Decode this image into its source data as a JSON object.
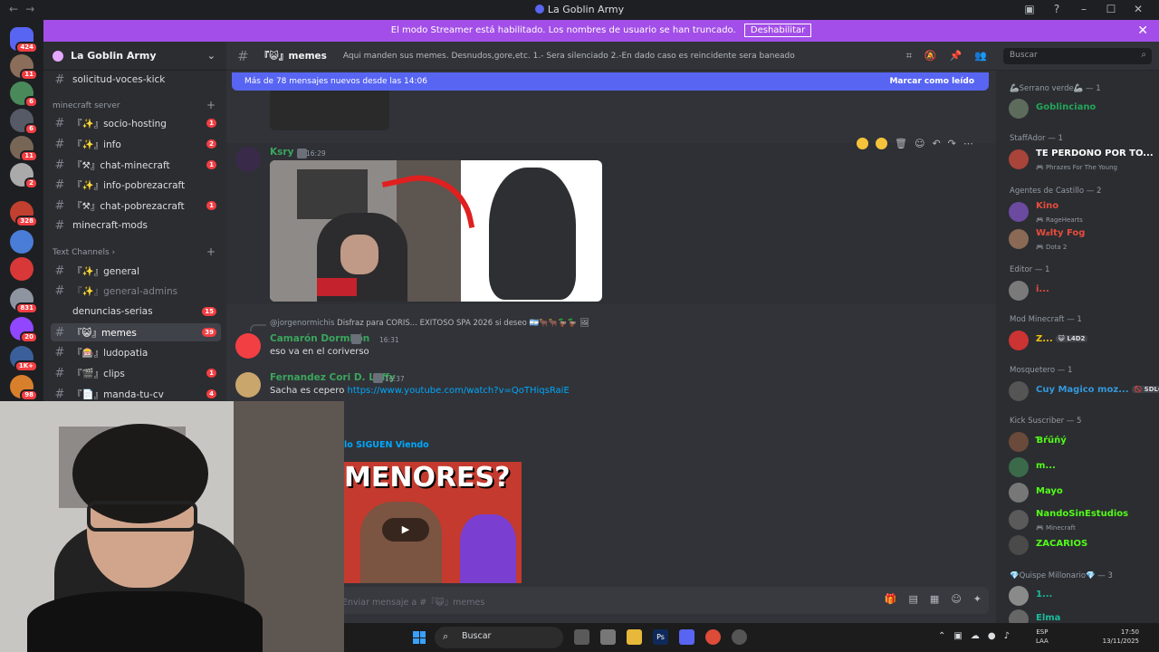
{
  "window": {
    "title": "La Goblin Army",
    "nav_back": "←",
    "nav_forward": "→",
    "controls": [
      "▣",
      "?",
      "–",
      "☐",
      "✕"
    ]
  },
  "banner": {
    "text": "El modo Streamer está habilitado. Los nombres de usuario se han truncado.",
    "button": "Deshabilitar",
    "close": "✕"
  },
  "servers": [
    {
      "badge": "424",
      "color": "#5865f2"
    },
    {
      "badge": "11",
      "color": "#8a6d5a"
    },
    {
      "badge": "6",
      "color": "#4a8a5a"
    },
    {
      "badge": "6",
      "color": "#555a66"
    },
    {
      "badge": "11",
      "color": "#776655"
    },
    {
      "badge": "2",
      "color": "#aaaaaa"
    },
    {
      "badge": "328",
      "color": "#c2402f"
    },
    {
      "badge": "",
      "color": "#4a7dd8"
    },
    {
      "badge": "",
      "color": "#d93838"
    },
    {
      "badge": "831",
      "color": "#8f95a0"
    },
    {
      "badge": "20",
      "color": "#9146ff"
    },
    {
      "badge": "1K+",
      "color": "#3a5f9a"
    },
    {
      "badge": "98",
      "color": "#d87f2b"
    }
  ],
  "sidebar": {
    "guild_name": "La Goblin Army",
    "chevron": "⌄",
    "categories": [
      "minecraft server",
      "Text Channels ›"
    ],
    "channels": [
      {
        "label": "solicitud-voces-kick",
        "badge": ""
      },
      {
        "label": "『✨』socio-hosting",
        "badge": "1"
      },
      {
        "label": "『✨』info",
        "badge": "2"
      },
      {
        "label": "『⚒』chat-minecraft",
        "badge": "1"
      },
      {
        "label": "『✨』info-pobrezacraft",
        "badge": ""
      },
      {
        "label": "『⚒』chat-pobrezacraft",
        "badge": "1"
      },
      {
        "label": "minecraft-mods",
        "badge": ""
      },
      {
        "label": "『✨』general",
        "badge": ""
      },
      {
        "label": "『✨』general-admins",
        "badge": ""
      },
      {
        "label": "denuncias-serias",
        "badge": "15"
      },
      {
        "label": "『😺』memes",
        "badge": "39"
      },
      {
        "label": "『🎰』ludopatia",
        "badge": ""
      },
      {
        "label": "『🎬』clips",
        "badge": "1"
      },
      {
        "label": "『📄』manda-tu-cv",
        "badge": "4"
      }
    ]
  },
  "chat": {
    "channel_name": "『😺』memes",
    "topic": "Aqui manden sus memes. Desnudos,gore,etc. 1.- Sera silenciado 2.-En dado caso es reincidente sera baneado",
    "search_placeholder": "Buscar",
    "new_messages": "Más de 78 mensajes nuevos desde las 14:06",
    "mark_read": "Marcar como leído",
    "composer_placeholder": "Enviar mensaje a #『😺』memes",
    "messages": [
      {
        "author": "Ksry",
        "time": "16:29",
        "color": "#3ba55d"
      },
      {
        "author": "Camarón Dormilón",
        "time": "16:31",
        "text": "eso va en el coriverso",
        "color": "#3ba55d",
        "reply_to": "@jorgenormichis",
        "reply_text": "Disfraz para CORIS... EXITOSO SPA 2026 si deseo 🇦🇷🐂🐂🦆🦆 🖼"
      },
      {
        "author": "Fernandez Cori D. Luffy",
        "time": "16:37",
        "text": "Sacha es cepero",
        "link": "https://www.youtube.com/watch?v=QoTHiqsRaiE",
        "color": "#3ba55d"
      }
    ],
    "embed_title": "lo SIGUEN Viendo",
    "embed_thumb_text": "MENORES?"
  },
  "members": {
    "groups": [
      {
        "title": "🦾Serrano verde🦾 — 1",
        "members": [
          {
            "name": "Goblinciano",
            "color": "#23a55a",
            "sub": ""
          }
        ]
      },
      {
        "title": "StaffAdor — 1",
        "members": [
          {
            "name": "TE PERDONO POR TO...",
            "color": "#ffffff",
            "sub": "🎮 Phrazes For The Young"
          }
        ]
      },
      {
        "title": "Agentes de Castillo — 2",
        "members": [
          {
            "name": "Kino",
            "color": "#e74c3c",
            "sub": "🎮 RageHearts"
          },
          {
            "name": "W𝓍lty Fog",
            "color": "#e74c3c",
            "sub": "🎮 Dota 2"
          }
        ]
      },
      {
        "title": "Editor — 1",
        "members": [
          {
            "name": "i...",
            "color": "#e74c3c",
            "sub": ""
          }
        ]
      },
      {
        "title": "Mod Minecraft — 1",
        "members": [
          {
            "name": "Z...",
            "color": "#f1c40f",
            "sub": "",
            "tag": "😺 L4D2"
          }
        ]
      },
      {
        "title": "Mosquetero — 1",
        "members": [
          {
            "name": "Cuy Magico moz...",
            "color": "#3498db",
            "sub": "",
            "tag": "🚫 SDLG"
          }
        ]
      },
      {
        "title": "Kick Suscriber — 5",
        "members": [
          {
            "name": "Ɓŕűńý",
            "color": "#53fc18",
            "sub": ""
          },
          {
            "name": "m...",
            "color": "#53fc18",
            "sub": ""
          },
          {
            "name": "Mayo",
            "color": "#53fc18",
            "sub": ""
          },
          {
            "name": "NandoSinEstudios",
            "color": "#53fc18",
            "sub": "🎮 Minecraft"
          },
          {
            "name": "ZACARIOS",
            "color": "#53fc18",
            "sub": ""
          }
        ]
      },
      {
        "title": "💎Quispe Millonario💎 — 3",
        "members": [
          {
            "name": "1...",
            "color": "#1abc9c",
            "sub": ""
          },
          {
            "name": "Elma",
            "color": "#1abc9c",
            "sub": ""
          }
        ]
      }
    ]
  },
  "taskbar": {
    "search": "Buscar",
    "lang_line1": "ESP",
    "lang_line2": "LAA",
    "time": "17:50",
    "date": "13/11/2025"
  }
}
